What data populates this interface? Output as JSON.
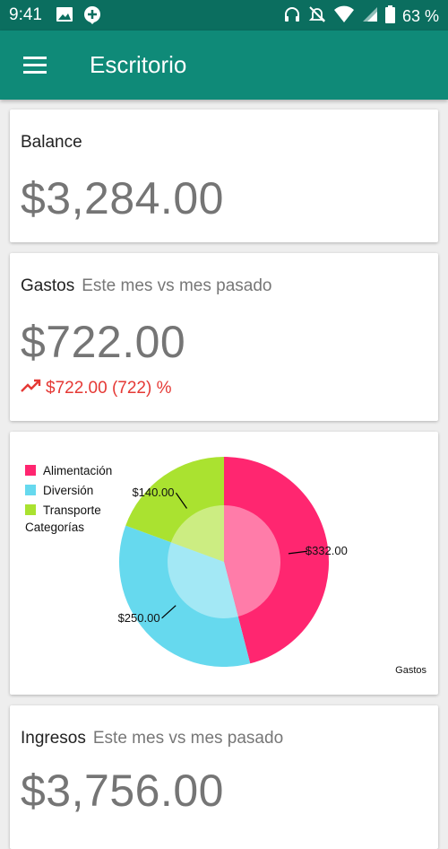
{
  "status_bar": {
    "time": "9:41",
    "battery": "63 %"
  },
  "app_bar": {
    "title": "Escritorio"
  },
  "balance_card": {
    "title": "Balance",
    "amount": "$3,284.00"
  },
  "expenses_card": {
    "title": "Gastos",
    "subtitle": "Este mes vs mes pasado",
    "amount": "$722.00",
    "trend_text": "$722.00 (722) %",
    "trend_color": "#e53935"
  },
  "categories_chart": {
    "legend_title": "Categorías",
    "description": "Gastos"
  },
  "chart_data": {
    "type": "pie",
    "categories": [
      "Alimentación",
      "Diversión",
      "Transporte"
    ],
    "values": [
      332,
      250,
      140
    ],
    "labels": [
      "$332.00",
      "$250.00",
      "$140.00"
    ],
    "colors": [
      "#ff2670",
      "#66d9ee",
      "#aae230"
    ],
    "legend_title": "Categorías",
    "description": "Gastos",
    "legend_position": "top-left"
  },
  "income_card": {
    "title": "Ingresos",
    "subtitle": "Este mes vs mes pasado",
    "amount": "$3,756.00"
  },
  "colors": {
    "status_bar": "#0b6e5f",
    "app_bar": "#0f8a78",
    "background": "#eeeeee"
  }
}
